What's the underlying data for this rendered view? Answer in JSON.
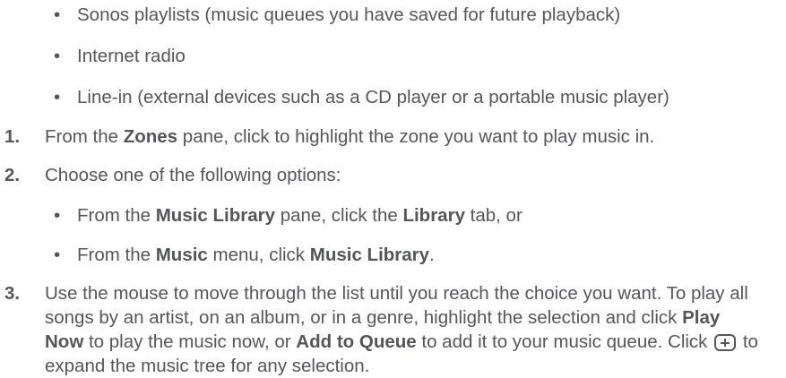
{
  "source_bullets": [
    {
      "text": "Sonos playlists (music queues you have saved for future playback)"
    },
    {
      "text": "Internet radio"
    },
    {
      "text": "Line-in (external devices such as a CD player or a portable music player)"
    }
  ],
  "bullet_glyph": "•",
  "step1": {
    "num": "1.",
    "pre": "From the ",
    "b1": "Zones",
    "post": " pane, click to highlight the zone you want to play music in."
  },
  "step2": {
    "num": "2.",
    "text": "Choose one of the following options:"
  },
  "options": {
    "opt1": {
      "pre": "From the ",
      "b1": "Music Library",
      "mid": " pane, click the ",
      "b2": "Library",
      "post": " tab, or"
    },
    "opt2": {
      "pre": "From the ",
      "b1": "Music",
      "mid": " menu, click ",
      "b2": "Music Library",
      "post": "."
    }
  },
  "step3": {
    "num": "3.",
    "pre": "Use the mouse to move through the list until you reach the choice you want. To play all songs by an artist, on an album, or in a genre, highlight the selection and click ",
    "b1": "Play Now",
    "mid": " to play the music now, or ",
    "b2": "Add to Queue",
    "mid2": " to add it to your music queue. Click ",
    "post": " to expand the music tree for any selection."
  }
}
